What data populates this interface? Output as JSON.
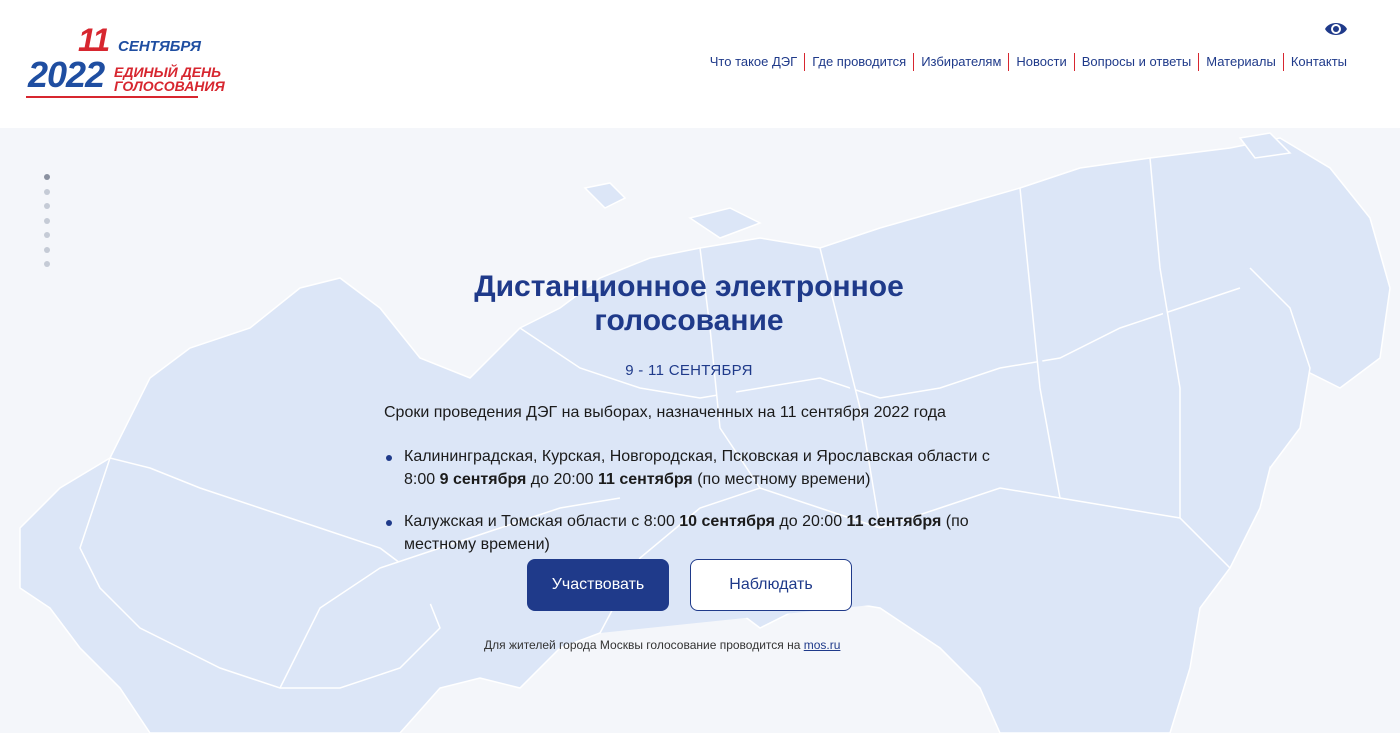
{
  "logo": {
    "day": "11",
    "month": "СЕНТЯБРЯ",
    "year": "2022",
    "line1": "ЕДИНЫЙ ДЕНЬ",
    "line2": "ГОЛОСОВАНИЯ"
  },
  "nav": {
    "items": [
      "Что такое ДЭГ",
      "Где проводится",
      "Избирателям",
      "Новости",
      "Вопросы и ответы",
      "Материалы",
      "Контакты"
    ],
    "eye_icon": "eye-icon"
  },
  "colors": {
    "brand_blue": "#1f3a8a",
    "brand_red": "#d7262f",
    "map_fill": "#dce6f7"
  },
  "slider": {
    "dots": 7,
    "active_index": 0
  },
  "hero": {
    "title": "Дистанционное электронное голосование",
    "dates": "9 - 11 СЕНТЯБРЯ",
    "intro": "Сроки проведения ДЭГ на выборах, назначенных на 11 сентября 2022 года",
    "bullet1": {
      "part1": "Калининградская, Курская, Новгородская, Псковская и Ярославская области с 8:00 ",
      "bold1": "9 сентября",
      "part2": " до 20:00 ",
      "bold2": "11 сентября",
      "part3": " (по местному времени)"
    },
    "bullet2": {
      "part1": "Калужская и Томская области с 8:00 ",
      "bold1": "10 сентября",
      "part2": " до 20:00 ",
      "bold2": "11 сентября",
      "part3": " (по местному времени)"
    },
    "participate_label": "Участвовать",
    "observe_label": "Наблюдать",
    "footnote_text": "Для жителей города Москвы голосование проводится на ",
    "footnote_link": "mos.ru"
  }
}
